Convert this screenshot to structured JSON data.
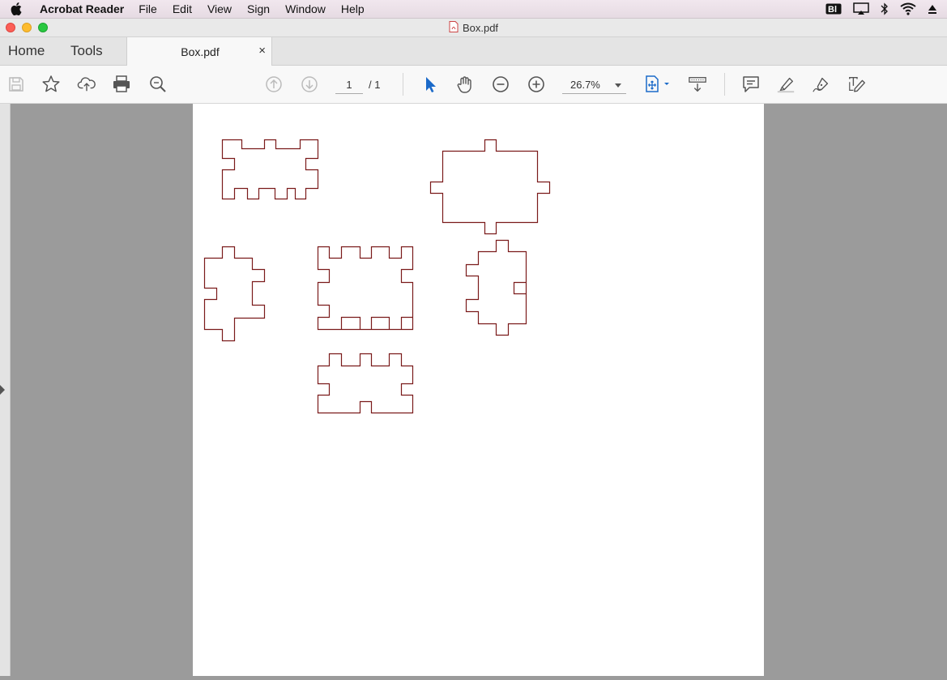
{
  "menubar": {
    "app_name": "Acrobat Reader",
    "items": [
      "File",
      "Edit",
      "View",
      "Sign",
      "Window",
      "Help"
    ],
    "status_icons": [
      "bi-icon",
      "airplay-icon",
      "bluetooth-icon",
      "wifi-icon",
      "eject-icon"
    ]
  },
  "window": {
    "title": "Box.pdf"
  },
  "tabs": {
    "home": "Home",
    "tools": "Tools",
    "document": "Box.pdf",
    "close_glyph": "×"
  },
  "toolbar": {
    "page_current": "1",
    "page_total": "/ 1",
    "zoom": "26.7%",
    "left_tools": [
      "save-icon",
      "bookmark-star-icon",
      "cloud-upload-icon",
      "print-icon",
      "zoom-search-icon"
    ],
    "nav_tools": [
      "page-up-icon",
      "page-down-icon"
    ],
    "view_tools": [
      "select-cursor-icon",
      "hand-tool-icon",
      "zoom-out-icon",
      "zoom-in-icon",
      "fit-page-icon",
      "scroll-mode-icon"
    ],
    "annot_tools": [
      "comment-icon",
      "highlight-icon",
      "sign-pen-icon",
      "edit-text-icon"
    ]
  },
  "document": {
    "stroke_color": "#7a1a1a",
    "accent_color": "#1b6ac9",
    "pieces": [
      "box-panel-top-left",
      "box-panel-large-top",
      "box-panel-side-left",
      "box-panel-center",
      "box-panel-side-right",
      "box-panel-bottom"
    ]
  }
}
